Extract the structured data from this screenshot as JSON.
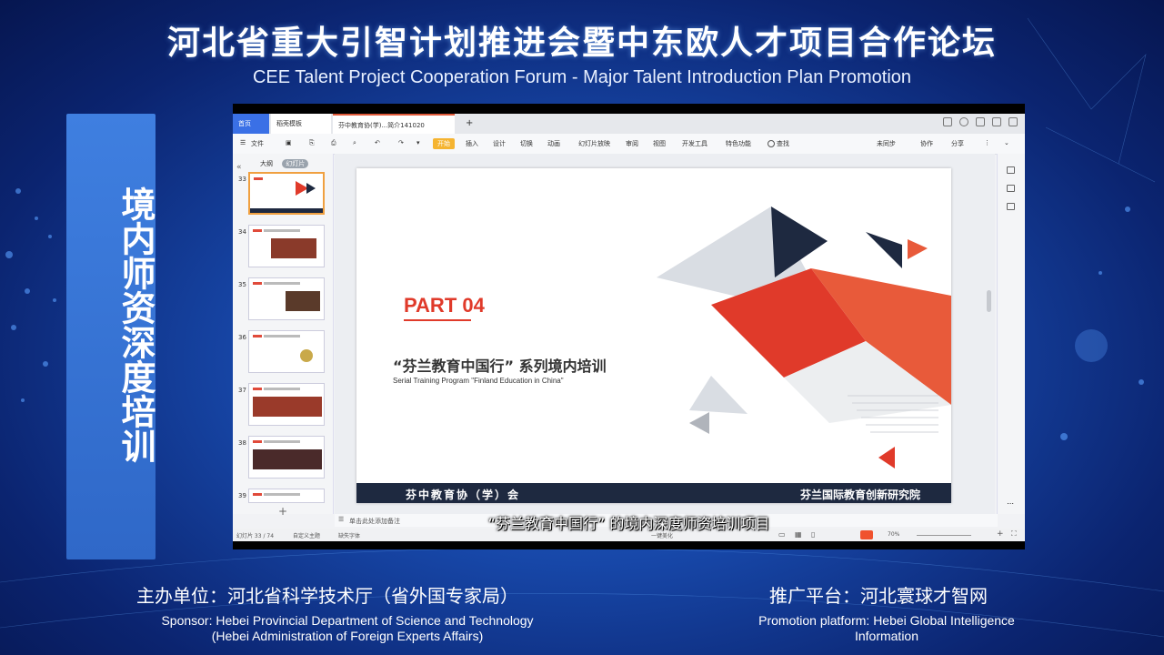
{
  "header": {
    "title": "河北省重大引智计划推进会暨中东欧人才项目合作论坛",
    "subtitle": "CEE Talent Project Cooperation Forum - Major Talent Introduction Plan Promotion"
  },
  "side_panel": {
    "text": "境内师资深度培训"
  },
  "app": {
    "tabs": [
      "首页",
      "稻壳模板",
      "芬中教育协(学)...简介141020"
    ],
    "menu": {
      "file": "文件",
      "items": [
        "开始",
        "插入",
        "设计",
        "切换",
        "动画",
        "幻灯片放映",
        "审阅",
        "视图",
        "开发工具",
        "特色功能"
      ],
      "search": "查找",
      "right": [
        "未同步",
        "协作",
        "分享"
      ]
    },
    "left_panel": {
      "tab_outline": "大纲",
      "tab_slides": "幻灯片",
      "slide_numbers": [
        "33",
        "34",
        "35",
        "36",
        "37",
        "38",
        "39"
      ]
    },
    "notes_placeholder": "单击此处添加备注",
    "status": {
      "slide_count": "幻灯片 33 / 74",
      "theme": "自定义主题",
      "font_missing": "缺失字体",
      "notes": "一键美化",
      "zoom": "70%"
    }
  },
  "slide": {
    "part_label": "PART 04",
    "title_cn": "“芬兰教育中国行” 系列境内培训",
    "title_en": "Serial Training Program \"Finland Education in China\"",
    "footer_left": "芬中教育协（学）会",
    "footer_right": "芬兰国际教育创新研究院",
    "colors": {
      "accent": "#e03a2a",
      "dark": "#1e2940",
      "grey": "#d9dde3"
    }
  },
  "caption": "“芬兰教育中国行” 的境内深度师资培训项目",
  "footer": {
    "host_label": "主办单位：河北省科学技术厅（省外国专家局）",
    "host_en_1": "Sponsor: Hebei Provincial Department of Science and Technology",
    "host_en_2": "(Hebei Administration of Foreign Experts Affairs)",
    "promo_label": "推广平台：河北寰球才智网",
    "promo_en_1": "Promotion platform: Hebei Global Intelligence",
    "promo_en_2": "Information"
  }
}
